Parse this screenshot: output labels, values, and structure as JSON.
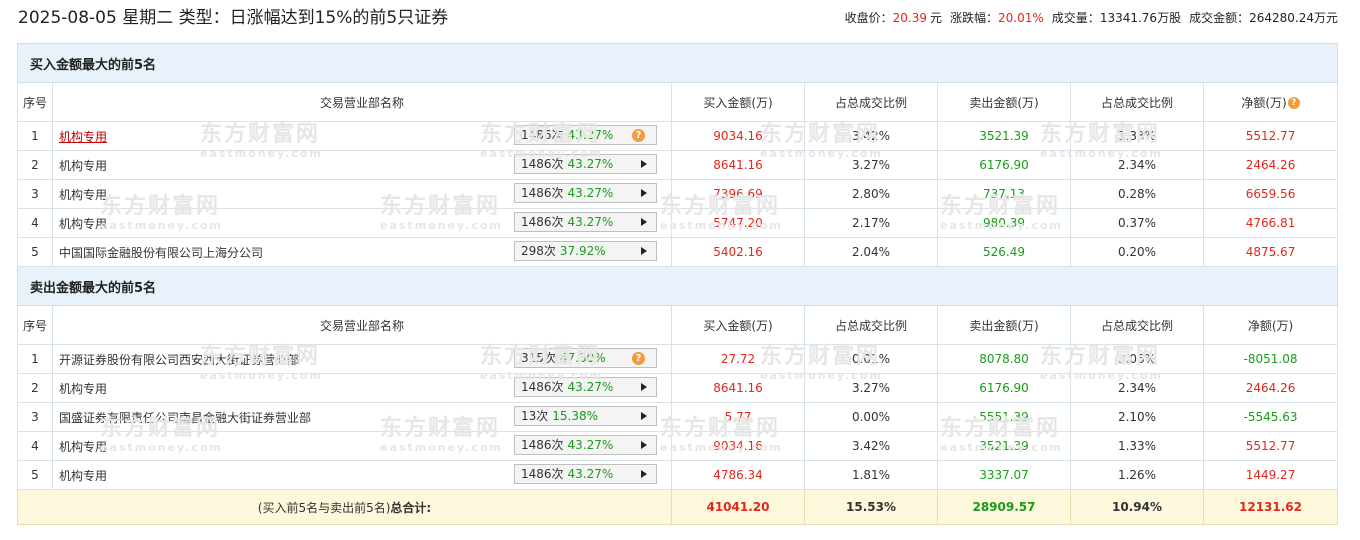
{
  "title": "2025-08-05 星期二 类型：日涨幅达到15%的前5只证券",
  "summary": {
    "close_label": "收盘价：",
    "close_value": "20.39",
    "close_unit": "元",
    "change_label": "涨跌幅：",
    "change_value": "20.01%",
    "volume_label": "成交量：",
    "volume_value": "13341.76万股",
    "amount_label": "成交金额：",
    "amount_value": "264280.24万元"
  },
  "columns": {
    "idx": "序号",
    "name": "交易营业部名称",
    "buy": "买入金额(万)",
    "buy_pct": "占总成交比例",
    "sell": "卖出金额(万)",
    "sell_pct": "占总成交比例",
    "net": "净额(万)"
  },
  "watermark": {
    "cn": "东方财富网",
    "en": "eastmoney.com"
  },
  "buy_section": {
    "title": "买入金额最大的前5名",
    "rows": [
      {
        "idx": "1",
        "name": "机构专用",
        "link": true,
        "count": "1486次",
        "rate": "43.27%",
        "icon": "question-icon",
        "buy": "9034.16",
        "buy_pct": "3.42%",
        "sell": "3521.39",
        "sell_pct": "1.33%",
        "net": "5512.77",
        "net_color": "red"
      },
      {
        "idx": "2",
        "name": "机构专用",
        "link": false,
        "count": "1486次",
        "rate": "43.27%",
        "icon": "arrow-right-icon",
        "buy": "8641.16",
        "buy_pct": "3.27%",
        "sell": "6176.90",
        "sell_pct": "2.34%",
        "net": "2464.26",
        "net_color": "red"
      },
      {
        "idx": "3",
        "name": "机构专用",
        "link": false,
        "count": "1486次",
        "rate": "43.27%",
        "icon": "arrow-right-icon",
        "buy": "7396.69",
        "buy_pct": "2.80%",
        "sell": "737.13",
        "sell_pct": "0.28%",
        "net": "6659.56",
        "net_color": "red"
      },
      {
        "idx": "4",
        "name": "机构专用",
        "link": false,
        "count": "1486次",
        "rate": "43.27%",
        "icon": "arrow-right-icon",
        "buy": "5747.20",
        "buy_pct": "2.17%",
        "sell": "980.39",
        "sell_pct": "0.37%",
        "net": "4766.81",
        "net_color": "red"
      },
      {
        "idx": "5",
        "name": "中国国际金融股份有限公司上海分公司",
        "link": false,
        "count": "298次",
        "rate": "37.92%",
        "icon": "arrow-right-icon",
        "buy": "5402.16",
        "buy_pct": "2.04%",
        "sell": "526.49",
        "sell_pct": "0.20%",
        "net": "4875.67",
        "net_color": "red"
      }
    ]
  },
  "sell_section": {
    "title": "卖出金额最大的前5名",
    "rows": [
      {
        "idx": "1",
        "name": "开源证券股份有限公司西安西大街证券营业部",
        "link": false,
        "count": "315次",
        "rate": "47.30%",
        "icon": "question-icon",
        "buy": "27.72",
        "buy_pct": "0.01%",
        "sell": "8078.80",
        "sell_pct": "3.06%",
        "net": "-8051.08",
        "net_color": "green"
      },
      {
        "idx": "2",
        "name": "机构专用",
        "link": false,
        "count": "1486次",
        "rate": "43.27%",
        "icon": "arrow-right-icon",
        "buy": "8641.16",
        "buy_pct": "3.27%",
        "sell": "6176.90",
        "sell_pct": "2.34%",
        "net": "2464.26",
        "net_color": "red"
      },
      {
        "idx": "3",
        "name": "国盛证券有限责任公司南昌金融大街证券营业部",
        "link": false,
        "count": "13次",
        "rate": "15.38%",
        "icon": "arrow-right-icon",
        "buy": "5.77",
        "buy_pct": "0.00%",
        "sell": "5551.39",
        "sell_pct": "2.10%",
        "net": "-5545.63",
        "net_color": "green"
      },
      {
        "idx": "4",
        "name": "机构专用",
        "link": false,
        "count": "1486次",
        "rate": "43.27%",
        "icon": "arrow-right-icon",
        "buy": "9034.16",
        "buy_pct": "3.42%",
        "sell": "3521.39",
        "sell_pct": "1.33%",
        "net": "5512.77",
        "net_color": "red"
      },
      {
        "idx": "5",
        "name": "机构专用",
        "link": false,
        "count": "1486次",
        "rate": "43.27%",
        "icon": "arrow-right-icon",
        "buy": "4786.34",
        "buy_pct": "1.81%",
        "sell": "3337.07",
        "sell_pct": "1.26%",
        "net": "1449.27",
        "net_color": "red"
      }
    ]
  },
  "total": {
    "label_prefix": "(买入前5名与卖出前5名)",
    "label_bold": "总合计:",
    "buy": "41041.20",
    "buy_pct": "15.53%",
    "sell": "28909.57",
    "sell_pct": "10.94%",
    "net": "12131.62"
  }
}
